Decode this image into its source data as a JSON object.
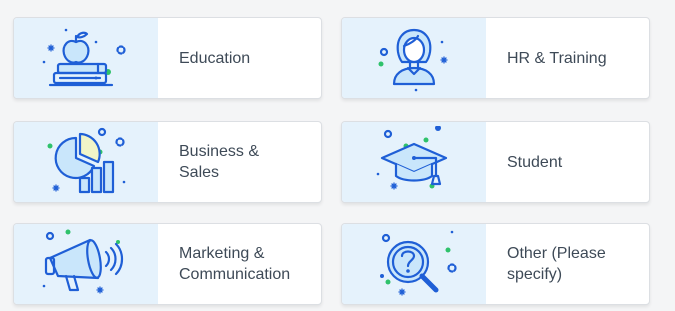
{
  "categories": [
    {
      "label": "Education",
      "icon": "apple-books-icon"
    },
    {
      "label": "HR & Training",
      "icon": "person-icon"
    },
    {
      "label": "Business &\nSales",
      "icon": "pie-bar-chart-icon"
    },
    {
      "label": "Student",
      "icon": "graduation-cap-icon"
    },
    {
      "label": "Marketing &\nCommunication",
      "icon": "megaphone-icon"
    },
    {
      "label": "Other (Please\nspecify)",
      "icon": "question-magnifier-icon"
    }
  ],
  "colors": {
    "accent": "#1f5fd6",
    "icon_panel": "#e5f2fc",
    "label_text": "#3e4a57",
    "decor_green": "#2fc26b"
  }
}
